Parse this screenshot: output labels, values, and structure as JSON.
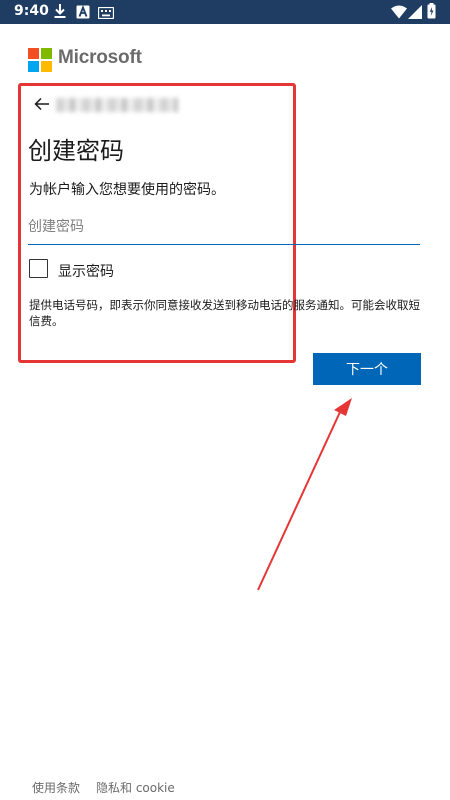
{
  "status_bar": {
    "time": "9:40",
    "icons": [
      "download-icon",
      "a-letter-icon",
      "keyboard-icon",
      "wifi-icon",
      "signal-icon",
      "battery-icon"
    ]
  },
  "brand": {
    "name": "Microsoft",
    "colors": {
      "red": "#f25022",
      "green": "#7fba00",
      "blue": "#00a4ef",
      "yellow": "#ffb900"
    }
  },
  "form": {
    "title": "创建密码",
    "instruction": "为帐户输入您想要使用的密码。",
    "password_placeholder": "创建密码",
    "password_value": "",
    "show_password_label": "显示密码",
    "show_password_checked": false,
    "notice": "提供电话号码，即表示你同意接收发送到移动电话的服务通知。可能会收取短信费。",
    "next_label": "下一个"
  },
  "footer": {
    "terms_label": "使用条款",
    "privacy_label": "隐私和 cookie"
  },
  "colors": {
    "status_bar": "#1f3d63",
    "accent": "#0067b8",
    "annotation": "#e63535"
  }
}
